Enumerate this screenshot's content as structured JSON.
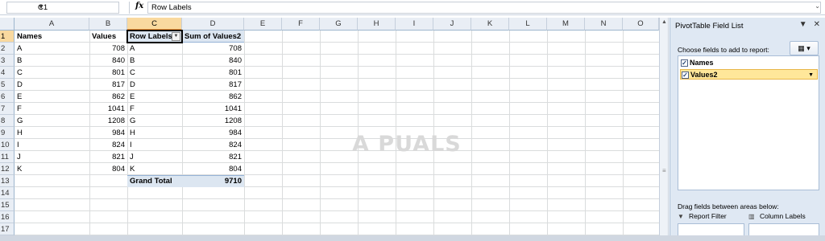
{
  "formula_bar": {
    "name_box": "C1",
    "fx_label": "fx",
    "formula": "Row Labels"
  },
  "columns": [
    "A",
    "B",
    "C",
    "D",
    "E",
    "F",
    "G",
    "H",
    "I",
    "J",
    "K",
    "L",
    "M",
    "N",
    "O"
  ],
  "selected_column": "C",
  "rows": [
    "1",
    "2",
    "3",
    "4",
    "5",
    "6",
    "7",
    "8",
    "9",
    "10",
    "11",
    "12",
    "13",
    "14",
    "15",
    "16",
    "17"
  ],
  "selected_row": "1",
  "sheet": {
    "headers": {
      "a": "Names",
      "b": "Values",
      "c": "Row Labels",
      "d": "Sum of Values2"
    },
    "data_rows": [
      {
        "name": "A",
        "value": "708",
        "label": "A",
        "sum": "708"
      },
      {
        "name": "B",
        "value": "840",
        "label": "B",
        "sum": "840"
      },
      {
        "name": "C",
        "value": "801",
        "label": "C",
        "sum": "801"
      },
      {
        "name": "D",
        "value": "817",
        "label": "D",
        "sum": "817"
      },
      {
        "name": "E",
        "value": "862",
        "label": "E",
        "sum": "862"
      },
      {
        "name": "F",
        "value": "1041",
        "label": "F",
        "sum": "1041"
      },
      {
        "name": "G",
        "value": "1208",
        "label": "G",
        "sum": "1208"
      },
      {
        "name": "H",
        "value": "984",
        "label": "H",
        "sum": "984"
      },
      {
        "name": "I",
        "value": "824",
        "label": "I",
        "sum": "824"
      },
      {
        "name": "J",
        "value": "821",
        "label": "J",
        "sum": "821"
      },
      {
        "name": "K",
        "value": "804",
        "label": "K",
        "sum": "804"
      }
    ],
    "grand_total_label": "Grand Total",
    "grand_total_value": "9710"
  },
  "watermark": "A PUALS",
  "pivot_panel": {
    "title": "PivotTable Field List",
    "choose_text": "Choose fields to add to report:",
    "fields": [
      {
        "label": "Names",
        "checked": true
      },
      {
        "label": "Values2",
        "checked": true
      }
    ],
    "drag_text": "Drag fields between areas below:",
    "report_filter_label": "Report Filter",
    "column_labels_label": "Column Labels"
  },
  "colors": {
    "header_bg": "#e9eef5",
    "selected_header_bg": "#f9d99f",
    "pivot_header_bg": "#dce6f1",
    "panel_bg": "#dfe8f3",
    "field_highlight": "#ffe79a"
  }
}
